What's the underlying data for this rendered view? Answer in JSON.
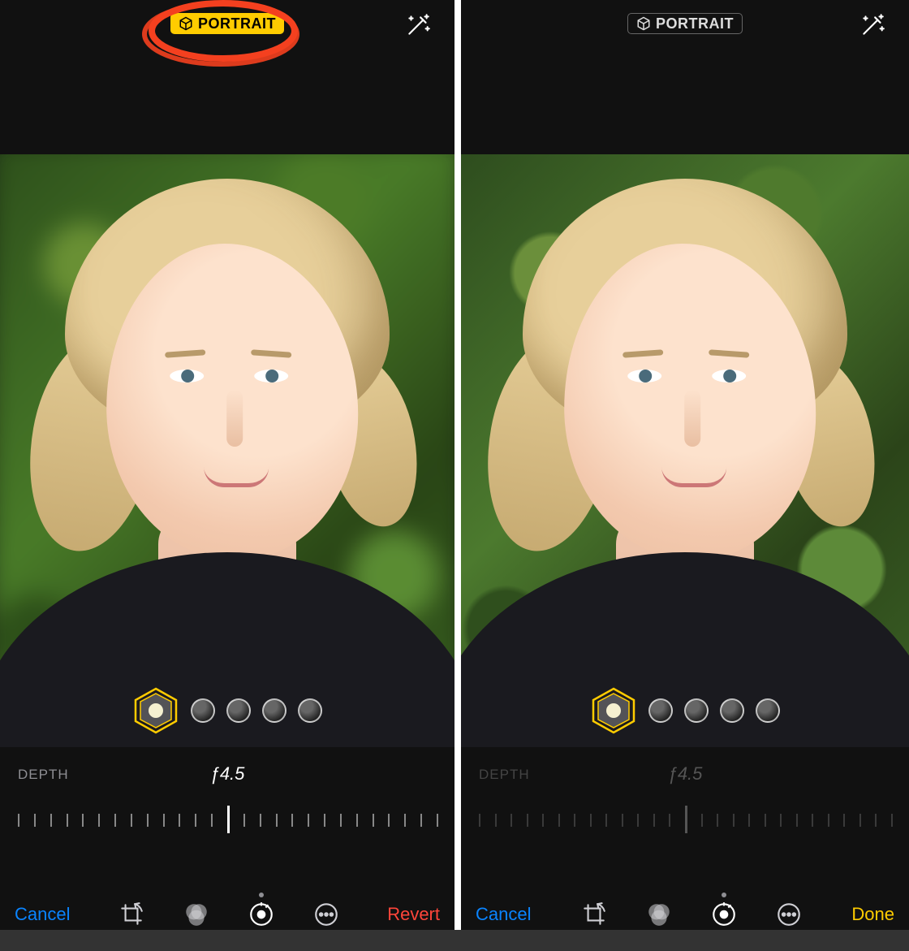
{
  "left": {
    "portrait_mode_label": "PORTRAIT",
    "portrait_mode_active": true,
    "depth_label": "DEPTH",
    "depth_value": "ƒ4.5",
    "depth_enabled": true,
    "toolbar": {
      "cancel": "Cancel",
      "primary": "Revert",
      "primary_style": "red"
    },
    "annotation": {
      "circled": true
    }
  },
  "right": {
    "portrait_mode_label": "PORTRAIT",
    "portrait_mode_active": false,
    "depth_label": "DEPTH",
    "depth_value": "ƒ4.5",
    "depth_enabled": false,
    "toolbar": {
      "cancel": "Cancel",
      "primary": "Done",
      "primary_style": "yellow"
    }
  },
  "lighting_options": [
    "natural",
    "studio",
    "contour",
    "stage",
    "stage-mono"
  ],
  "icons": {
    "portrait_badge": "cube-icon",
    "wand": "magic-wand-icon",
    "crop": "crop-rotate-icon",
    "filters": "filters-icon",
    "adjust": "adjust-dial-icon",
    "more": "ellipsis-circle-icon"
  },
  "colors": {
    "yellow": "#FFCC00",
    "blue": "#0A84FF",
    "red": "#FF453A",
    "annotation": "#F4401F"
  }
}
